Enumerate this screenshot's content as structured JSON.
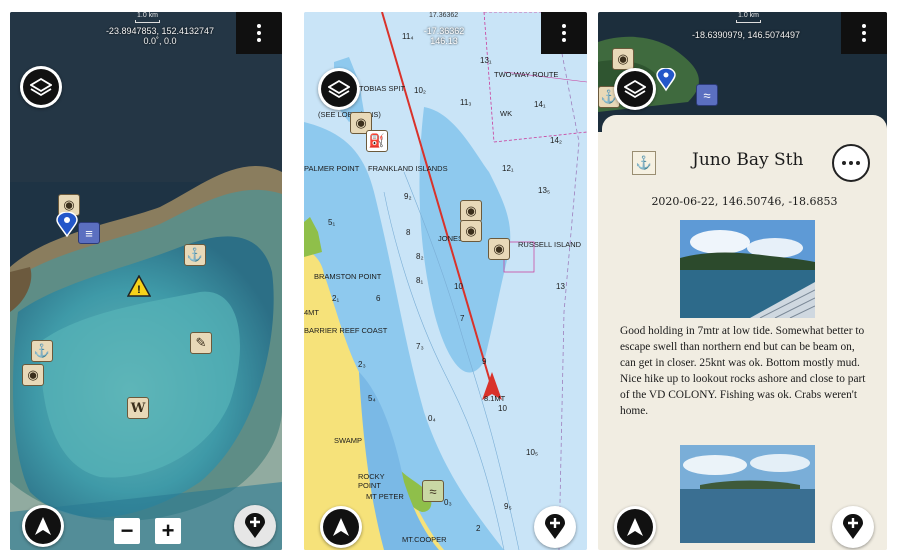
{
  "panel_satellite": {
    "scale_label": "1.0 km",
    "coord_line1": "-23.8947853, 152.4132747",
    "coord_line2": "0.0˚, 0.0",
    "zoom_out_label": "−",
    "zoom_in_label": "+",
    "icons": [
      "layers-icon",
      "menu-icon",
      "navigation-arrow-icon",
      "add-location-icon",
      "anchor-icon",
      "warning-icon",
      "wreck-icon"
    ]
  },
  "panel_chart": {
    "scale_label": "17.36362",
    "coord_line1": "-17.36362",
    "coord_line2": "146.13",
    "labels": {
      "tobias_spit": "TOBIAS SPIT",
      "see_lobs": "(SEE LOBS (ONS)",
      "two_way_route": "TWO-WAY ROUTE",
      "wk": "WK",
      "palmer_point": "PALMER POINT",
      "frankland_islands": "FRANKLAND ISLANDS",
      "jones_pat": "JONES PAT",
      "russell_island": "RUSSELL ISLAND",
      "bramston_point": "BRAMSTON POINT",
      "mt_4": "4MT",
      "barrier_reef_coast": "BARRIER REEF COAST",
      "swamp": "SWAMP",
      "rocky_point": "ROCKY\nPOINT",
      "mt_peter": "MT PETER",
      "mt_cooper": "MT.COOPER",
      "boat_label": "8.1MT"
    },
    "depths": [
      "11₄",
      "13₁",
      "10₂",
      "11₃",
      "14₁",
      "14₂",
      "12₁",
      "13₅",
      "9₂",
      "8",
      "8₁",
      "5₁",
      "6",
      "2₁",
      "8₂",
      "7",
      "10",
      "6",
      "13",
      "7₃",
      "9",
      "10",
      "2₃",
      "5₄",
      "0₄",
      "10₅",
      "9₅",
      "0₃",
      "2"
    ]
  },
  "panel_detail": {
    "scale_label": "1.0 km",
    "coord_line1": "-18.6390979, 146.5074497",
    "card": {
      "title": "Juno Bay Sth",
      "date_coords": "2020-06-22, 146.50746, -18.6853",
      "description": "Good holding in 7mtr at low tide. Somewhat better to escape swell than northern end but can be beam on,  can get in closer. 25knt was ok. Bottom mostly mud. Nice hike up to lookout rocks ashore and close to part of the VD COLONY. Fishing was ok. Crabs weren't home."
    }
  },
  "colors": {
    "water_chart": "#c9e4f7",
    "land_chart": "#f6e27a",
    "route_line": "#d9322b",
    "card_bg": "#f1ede2"
  }
}
